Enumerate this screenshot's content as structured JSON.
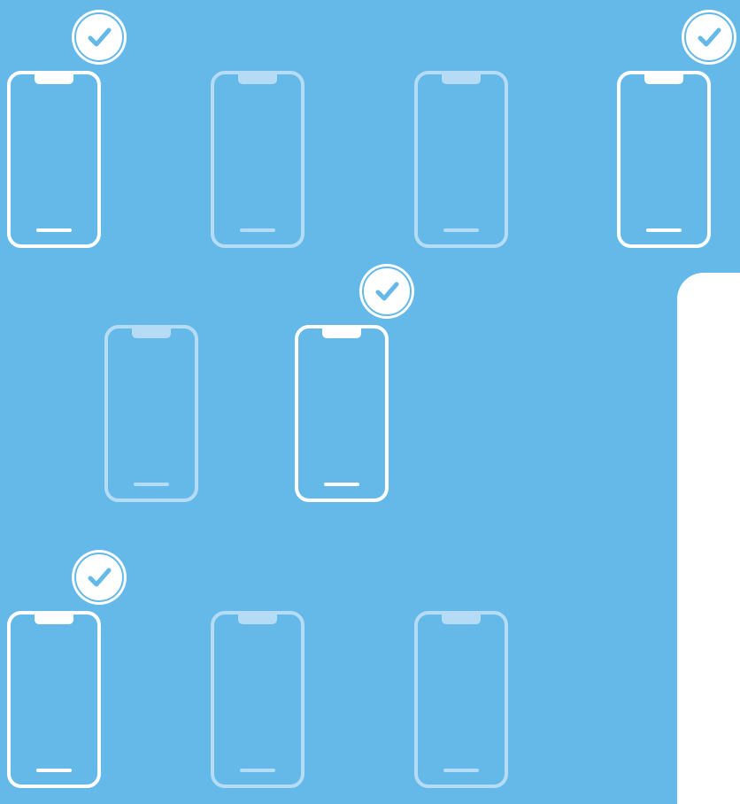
{
  "background_color": "#65b9e9",
  "panel_color": "#ffffff",
  "phone_outline_color_active": "#ffffff",
  "phone_outline_color_inactive": "#b5dcf4",
  "checkmark_color": "#65b9e9",
  "devices": [
    {
      "name": "phone-1",
      "state": "selected",
      "icon": "check-icon"
    },
    {
      "name": "phone-2",
      "state": "unselected"
    },
    {
      "name": "phone-3",
      "state": "unselected"
    },
    {
      "name": "phone-4",
      "state": "selected",
      "icon": "check-icon"
    },
    {
      "name": "phone-5",
      "state": "unselected"
    },
    {
      "name": "phone-6",
      "state": "selected",
      "icon": "check-icon"
    },
    {
      "name": "phone-7",
      "state": "selected",
      "icon": "check-icon"
    },
    {
      "name": "phone-8",
      "state": "unselected"
    },
    {
      "name": "phone-9",
      "state": "unselected"
    }
  ]
}
